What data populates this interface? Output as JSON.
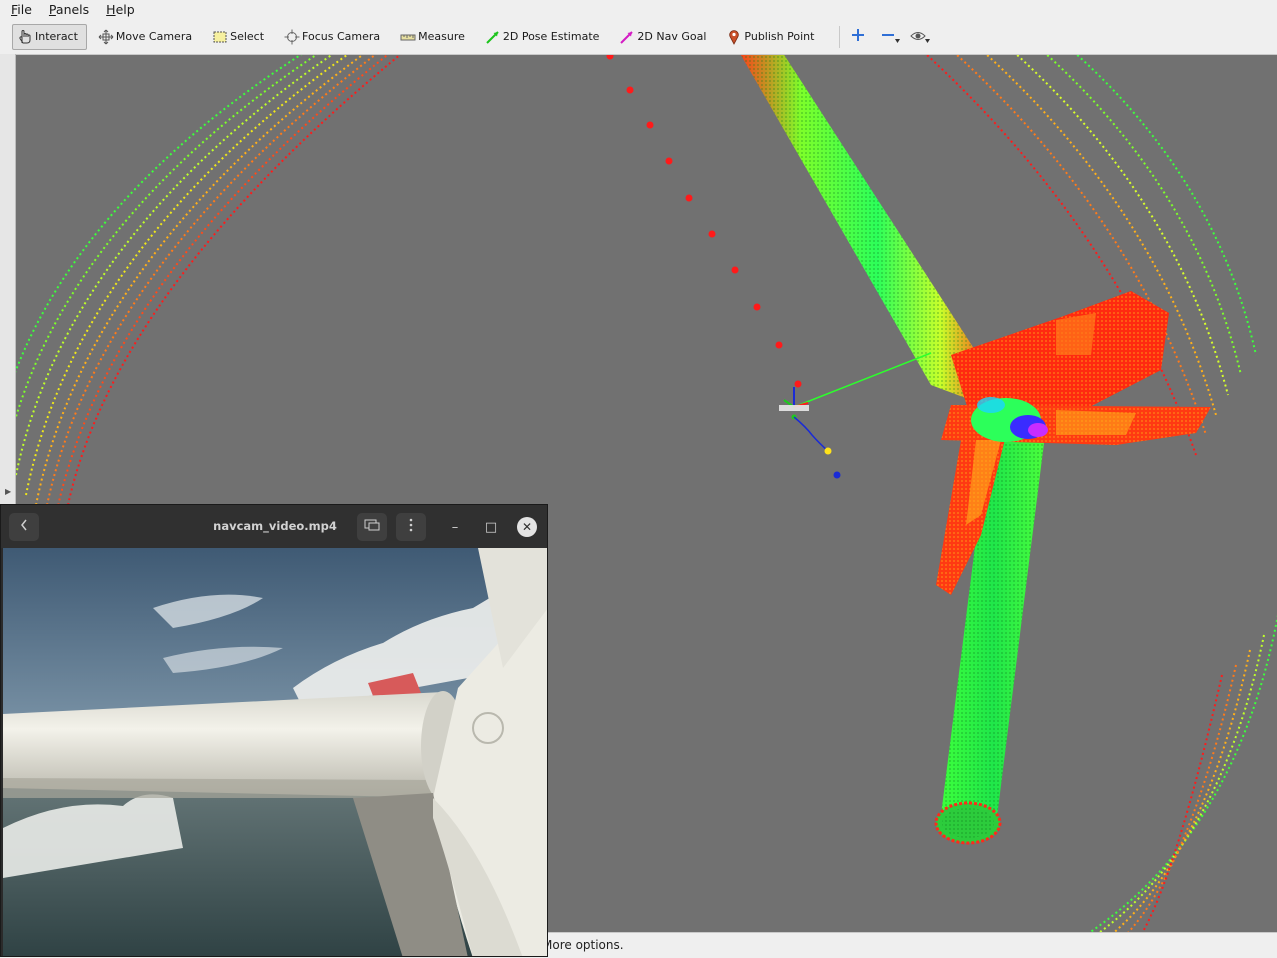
{
  "menu": [
    {
      "pre": "",
      "ul": "F",
      "post": "ile"
    },
    {
      "pre": "",
      "ul": "P",
      "post": "anels"
    },
    {
      "pre": "",
      "ul": "H",
      "post": "elp"
    }
  ],
  "toolbar": {
    "interact": "Interact",
    "move_camera": "Move Camera",
    "select": "Select",
    "focus_camera": "Focus Camera",
    "measure": "Measure",
    "pose_estimate": "2D Pose Estimate",
    "nav_goal": "2D Nav Goal",
    "publish_point": "Publish Point"
  },
  "icons": {
    "zoom_in": "plus-icon",
    "zoom_out": "minus-icon",
    "view": "eye-icon"
  },
  "colors": {
    "point_red": "#ff1a1a",
    "point_green": "#21ff3a",
    "point_orange": "#ff7a1a",
    "path_blue": "#1a2bd6",
    "goal_yellow": "#ffe21a"
  },
  "status": {
    "text": "More options."
  },
  "video": {
    "title": "navcam_video.mp4"
  }
}
